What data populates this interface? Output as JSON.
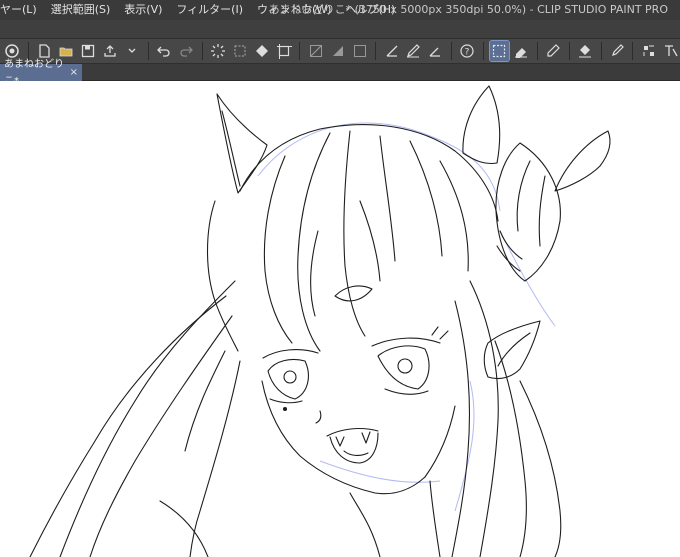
{
  "menu": {
    "items": [
      "ヤー(L)",
      "選択範囲(S)",
      "表示(V)",
      "フィルター(I)",
      "ウィンドウ(W)",
      "ヘルプ(H)"
    ]
  },
  "window": {
    "title": "あまねおどりこ* (3750 x 5000px 350dpi 50.0%) - CLIP STUDIO PAINT PRO"
  },
  "toolbar": {
    "buttons": [
      "clip-studio-icon",
      "new-icon",
      "open-icon",
      "save-icon",
      "export-icon",
      "undo-icon",
      "redo-icon",
      "loading-icon",
      "clear-icon",
      "fill-icon",
      "transform-icon",
      "crop-icon",
      "hide-icon",
      "ruler-icon",
      "vector-icon",
      "pen-icon",
      "help-icon",
      "selection-icon",
      "eraser-icon",
      "pencil-icon",
      "bucket-icon",
      "correction-icon",
      "layer-icon",
      "filter-icon"
    ],
    "active": "selection-icon"
  },
  "document": {
    "tab_label": "あまねおどりこ*",
    "close_label": "×"
  },
  "colors": {
    "title_bg": "#3a3a3a",
    "toolbar_bg": "#474747",
    "tab_active": "#5b6e92",
    "canvas_bg": "#ffffff",
    "line_art": "#1e1e1e",
    "sketch_blue": "#9aa4f0"
  }
}
